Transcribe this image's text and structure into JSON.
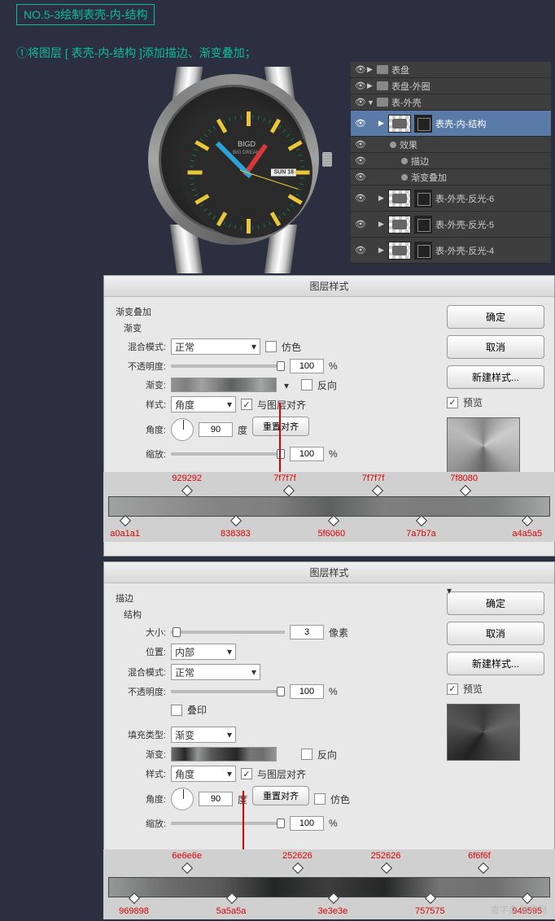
{
  "tutorial": {
    "step_title": "NO.5-3绘制表壳-内-结构",
    "instruction": "①将图层 [ 表壳-内-结构 ]添加描边、渐变叠加；"
  },
  "watch": {
    "brand": "BIGD",
    "brand_sub": "BIG DREAM",
    "date": "SUN 18"
  },
  "layers": {
    "items": [
      {
        "label": "表盘",
        "type": "folder",
        "visible": true,
        "expanded": false,
        "indent": 0
      },
      {
        "label": "表盘-外圈",
        "type": "folder",
        "visible": true,
        "expanded": false,
        "indent": 0
      },
      {
        "label": "表-外壳",
        "type": "folder",
        "visible": true,
        "expanded": true,
        "indent": 0
      },
      {
        "label": "表壳-内-结构",
        "type": "layer",
        "visible": true,
        "selected": true,
        "indent": 1
      },
      {
        "label": "效果",
        "type": "fx-header",
        "visible": true,
        "indent": 2
      },
      {
        "label": "描边",
        "type": "fx",
        "visible": true,
        "indent": 3
      },
      {
        "label": "渐变叠加",
        "type": "fx",
        "visible": true,
        "indent": 3
      },
      {
        "label": "表-外壳-反光-6",
        "type": "layer",
        "visible": true,
        "indent": 1
      },
      {
        "label": "表-外壳-反光-5",
        "type": "layer",
        "visible": true,
        "indent": 1
      },
      {
        "label": "表-外壳-反光-4",
        "type": "layer",
        "visible": true,
        "indent": 1
      }
    ]
  },
  "dialog1": {
    "title": "图层样式",
    "section": "渐变叠加",
    "subsection": "渐变",
    "blend_label": "混合模式:",
    "blend_value": "正常",
    "dither_label": "仿色",
    "opacity_label": "不透明度:",
    "opacity_value": "100",
    "percent": "%",
    "gradient_label": "渐变:",
    "reverse_label": "反向",
    "style_label": "样式:",
    "style_value": "角度",
    "align_label": "与图层对齐",
    "angle_label": "角度:",
    "angle_value": "90",
    "degree": "度",
    "reset_align": "重置对齐",
    "scale_label": "缩放:",
    "scale_value": "100",
    "buttons": {
      "ok": "确定",
      "cancel": "取消",
      "new_style": "新建样式...",
      "preview": "预览"
    }
  },
  "dialog2": {
    "title": "图层样式",
    "section": "描边",
    "subsection": "结构",
    "size_label": "大小:",
    "size_value": "3",
    "px": "像素",
    "position_label": "位置:",
    "position_value": "内部",
    "blend_label": "混合模式:",
    "blend_value": "正常",
    "opacity_label": "不透明度:",
    "opacity_value": "100",
    "percent": "%",
    "overprint_label": "叠印",
    "fill_type_label": "填充类型:",
    "fill_type_value": "渐变",
    "gradient_label": "渐变:",
    "reverse_label": "反向",
    "style_label": "样式:",
    "style_value": "角度",
    "align_label": "与图层对齐",
    "angle_label": "角度:",
    "angle_value": "90",
    "degree": "度",
    "reset_align": "重置对齐",
    "dither_label": "仿色",
    "scale_label": "缩放:",
    "scale_value": "100",
    "buttons": {
      "ok": "确定",
      "cancel": "取消",
      "new_style": "新建样式...",
      "preview": "预览"
    }
  },
  "gradient1": {
    "top_stops": [
      {
        "hex": "929292",
        "pos": 17
      },
      {
        "hex": "7f7f7f",
        "pos": 40
      },
      {
        "hex": "7f7f7f",
        "pos": 60
      },
      {
        "hex": "7f8080",
        "pos": 80
      }
    ],
    "bottom_stops": [
      {
        "hex": "a0a1a1",
        "pos": 3
      },
      {
        "hex": "838383",
        "pos": 28
      },
      {
        "hex": "5f6060",
        "pos": 50
      },
      {
        "hex": "7a7b7a",
        "pos": 70
      },
      {
        "hex": "a4a5a5",
        "pos": 94
      }
    ]
  },
  "gradient2": {
    "top_stops": [
      {
        "hex": "6e6e6e",
        "pos": 17
      },
      {
        "hex": "252626",
        "pos": 42
      },
      {
        "hex": "252626",
        "pos": 62
      },
      {
        "hex": "6f6f6f",
        "pos": 84
      }
    ],
    "bottom_stops": [
      {
        "hex": "969898",
        "pos": 5
      },
      {
        "hex": "5a5a5a",
        "pos": 27
      },
      {
        "hex": "3e3e3e",
        "pos": 50
      },
      {
        "hex": "757575",
        "pos": 72
      },
      {
        "hex": "949595",
        "pos": 94
      }
    ]
  },
  "watermark": "查字典 教程网"
}
